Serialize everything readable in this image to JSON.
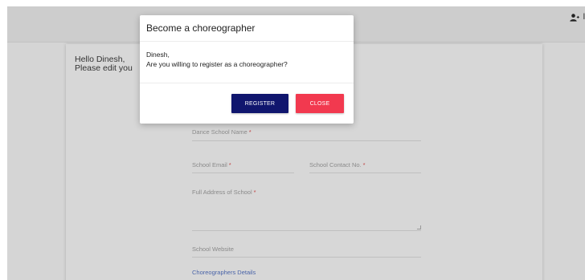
{
  "navbar": {
    "user_icon": "user-add-icon",
    "user_label": "l"
  },
  "form": {
    "greeting_line1": "Hello Dinesh,",
    "greeting_line2": "Please edit you",
    "dance_school_name_label": "Dance School Name",
    "school_email_label": "School Email",
    "school_contact_label": "School Contact No.",
    "full_address_label": "Full Address of School",
    "required_marker": "*",
    "school_website_label": "School Website",
    "choreographers_details_link": "Choreographers Details"
  },
  "modal": {
    "title": "Become a choreographer",
    "body_line1": "Dinesh,",
    "body_line2": "Are you willing to register as a choreographer?",
    "register_label": "REGISTER",
    "close_label": "CLOSE"
  },
  "colors": {
    "register_button": "#10166e",
    "close_button": "#f2394f",
    "overlay": "#d5d5d5"
  }
}
